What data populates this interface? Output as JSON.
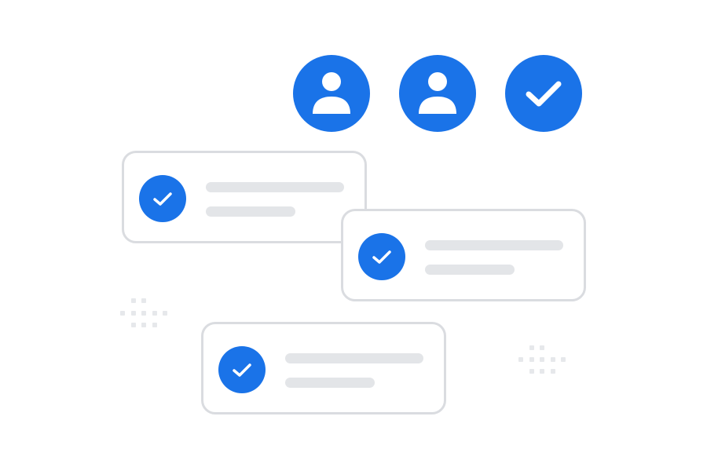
{
  "colors": {
    "accent": "#1a73e8",
    "card_border": "#dadce0",
    "placeholder_line": "#e3e5e8",
    "background": "#ffffff"
  },
  "header": {
    "avatars": [
      {
        "icon": "user-icon"
      },
      {
        "icon": "user-icon"
      },
      {
        "icon": "check-icon"
      }
    ]
  },
  "cards": [
    {
      "icon": "check-icon"
    },
    {
      "icon": "check-icon"
    },
    {
      "icon": "check-icon"
    }
  ],
  "decorations": [
    "dot-grid",
    "dot-grid"
  ]
}
